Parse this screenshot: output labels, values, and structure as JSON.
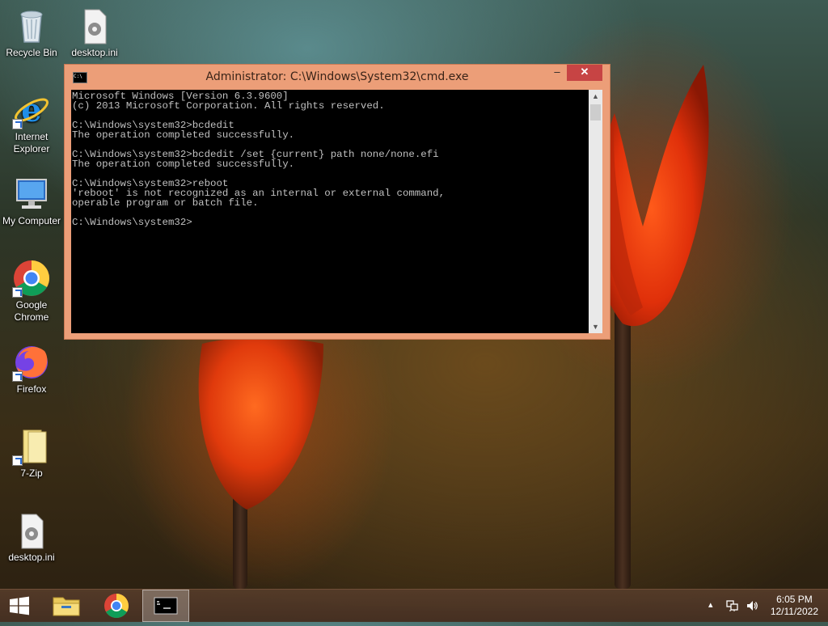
{
  "desktop": {
    "icons": [
      {
        "label": "Recycle Bin",
        "icon": "recycle-bin-icon"
      },
      {
        "label": "desktop.ini",
        "icon": "settings-file-icon"
      },
      {
        "label": "Internet Explorer",
        "icon": "internet-explorer-icon"
      },
      {
        "label": "My Computer",
        "icon": "computer-icon"
      },
      {
        "label": "Google Chrome",
        "icon": "chrome-icon"
      },
      {
        "label": "Firefox",
        "icon": "firefox-icon"
      },
      {
        "label": "7-Zip",
        "icon": "folder-icon"
      },
      {
        "label": "desktop.ini",
        "icon": "settings-file-icon"
      }
    ]
  },
  "window": {
    "title": "Administrator: C:\\Windows\\System32\\cmd.exe",
    "icon_text": "C:\\",
    "minimize": "–",
    "maximize": "☐",
    "close": "✕",
    "console_lines": [
      "Microsoft Windows [Version 6.3.9600]",
      "(c) 2013 Microsoft Corporation. All rights reserved.",
      "",
      "C:\\Windows\\system32>bcdedit",
      "The operation completed successfully.",
      "",
      "C:\\Windows\\system32>bcdedit /set {current} path none/none.efi",
      "The operation completed successfully.",
      "",
      "C:\\Windows\\system32>reboot",
      "'reboot' is not recognized as an internal or external command,",
      "operable program or batch file.",
      "",
      "C:\\Windows\\system32>"
    ]
  },
  "taskbar": {
    "items": [
      "start-icon",
      "file-explorer-icon",
      "chrome-icon",
      "command-prompt-icon"
    ],
    "tray": {
      "show_hidden": "▴",
      "time": "6:05 PM",
      "date": "12/11/2022"
    }
  }
}
